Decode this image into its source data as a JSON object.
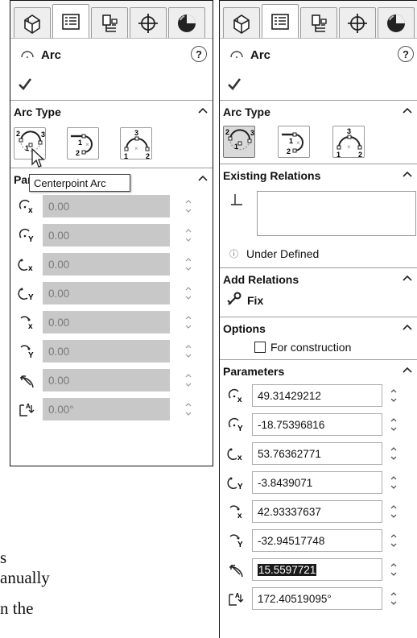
{
  "left_panel": {
    "tabs": [
      {
        "icon": "feature-manager-icon"
      },
      {
        "icon": "property-manager-icon"
      },
      {
        "icon": "configuration-manager-icon"
      },
      {
        "icon": "dimxpert-manager-icon"
      },
      {
        "icon": "display-manager-icon"
      }
    ],
    "title": "Arc",
    "help_glyph": "?",
    "arc_type_label": "Arc Type",
    "arc_buttons": [
      {
        "icon": "centerpoint-arc-icon",
        "selected": false
      },
      {
        "icon": "tangent-arc-icon",
        "selected": false
      },
      {
        "icon": "three-point-arc-icon",
        "selected": false
      }
    ],
    "parameters_label": "Par",
    "tooltip": "Centerpoint Arc",
    "params": [
      {
        "icon": "center-x-icon",
        "value": "0.00"
      },
      {
        "icon": "center-y-icon",
        "value": "0.00"
      },
      {
        "icon": "start-x-icon",
        "value": "0.00"
      },
      {
        "icon": "start-y-icon",
        "value": "0.00"
      },
      {
        "icon": "end-x-icon",
        "value": "0.00"
      },
      {
        "icon": "end-y-icon",
        "value": "0.00"
      },
      {
        "icon": "radius-icon",
        "value": "0.00"
      },
      {
        "icon": "angle-icon",
        "value": "0.00°"
      }
    ]
  },
  "right_panel": {
    "title": "Arc",
    "help_glyph": "?",
    "arc_type_label": "Arc Type",
    "arc_buttons": [
      {
        "icon": "centerpoint-arc-icon",
        "selected": true
      },
      {
        "icon": "tangent-arc-icon",
        "selected": false
      },
      {
        "icon": "three-point-arc-icon",
        "selected": false
      }
    ],
    "existing_relations_label": "Existing Relations",
    "info_glyph": "ⓘ",
    "under_defined": "Under Defined",
    "add_relations_label": "Add Relations",
    "fix_label": "Fix",
    "options_label": "Options",
    "for_construction_label": "For construction",
    "for_construction_checked": false,
    "parameters_label": "Parameters",
    "params": [
      {
        "icon": "center-x-icon",
        "value": "49.31429212"
      },
      {
        "icon": "center-y-icon",
        "value": "-18.75396816"
      },
      {
        "icon": "start-x-icon",
        "value": "53.76362771"
      },
      {
        "icon": "start-y-icon",
        "value": "-3.8439071"
      },
      {
        "icon": "end-x-icon",
        "value": "42.93337637"
      },
      {
        "icon": "end-y-icon",
        "value": "-32.94517748"
      },
      {
        "icon": "radius-icon",
        "value": "15.5597721",
        "highlighted": true
      },
      {
        "icon": "angle-icon",
        "value": "172.40519095°"
      }
    ]
  },
  "background_text": [
    "s",
    "anually",
    "n the"
  ]
}
